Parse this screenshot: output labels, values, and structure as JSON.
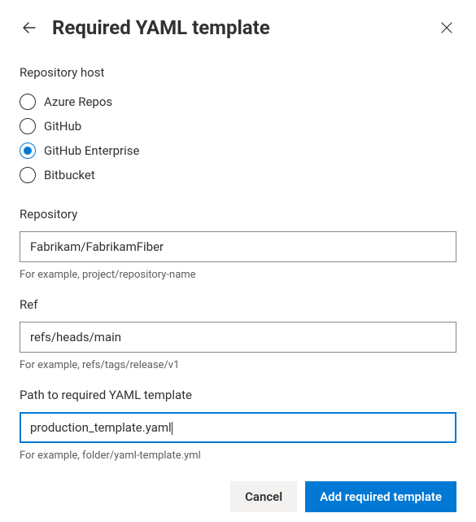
{
  "header": {
    "title": "Required YAML template"
  },
  "hostSection": {
    "label": "Repository host",
    "options": [
      {
        "label": "Azure Repos",
        "selected": false
      },
      {
        "label": "GitHub",
        "selected": false
      },
      {
        "label": "GitHub Enterprise",
        "selected": true
      },
      {
        "label": "Bitbucket",
        "selected": false
      }
    ]
  },
  "repository": {
    "label": "Repository",
    "value": "Fabrikam/FabrikamFiber",
    "hint": "For example, project/repository-name"
  },
  "ref": {
    "label": "Ref",
    "value": "refs/heads/main",
    "hint": "For example, refs/tags/release/v1"
  },
  "path": {
    "label": "Path to required YAML template",
    "value": "production_template.yaml",
    "hint": "For example, folder/yaml-template.yml"
  },
  "footer": {
    "cancel": "Cancel",
    "submit": "Add required template"
  }
}
